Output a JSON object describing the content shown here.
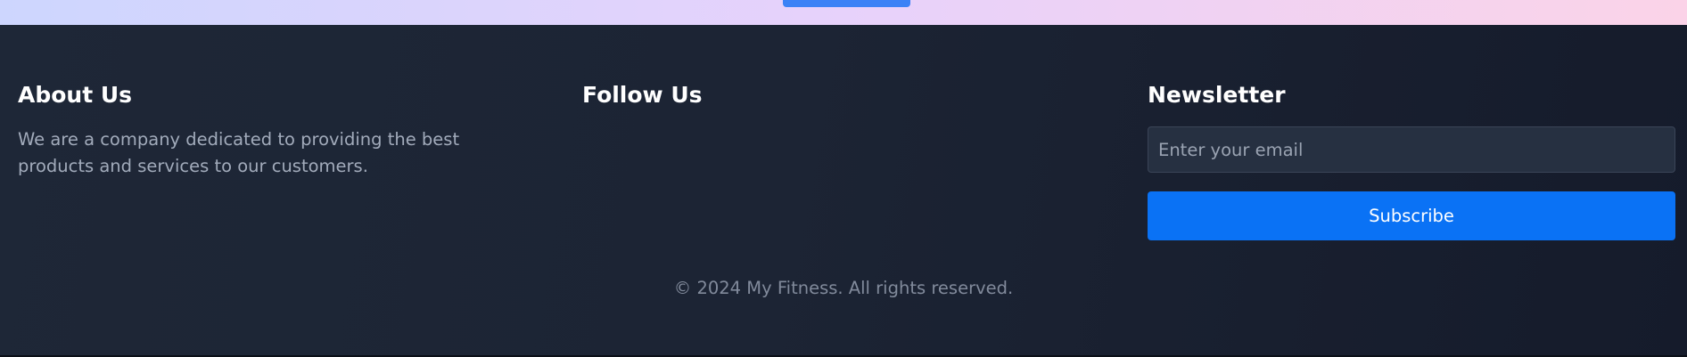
{
  "footer": {
    "about": {
      "title": "About Us",
      "text": "We are a company dedicated to providing the best products and services to our customers."
    },
    "follow": {
      "title": "Follow Us"
    },
    "newsletter": {
      "title": "Newsletter",
      "email_value": "",
      "email_placeholder": "Enter your email",
      "subscribe_label": "Subscribe"
    },
    "copyright": "© 2024 My Fitness. All rights reserved."
  },
  "colors": {
    "footer_background": "#1b2232",
    "accent_button": "#0a72f5",
    "heading_text": "#ffffff",
    "body_text": "#a2abbb",
    "muted_text": "#818a9b"
  }
}
